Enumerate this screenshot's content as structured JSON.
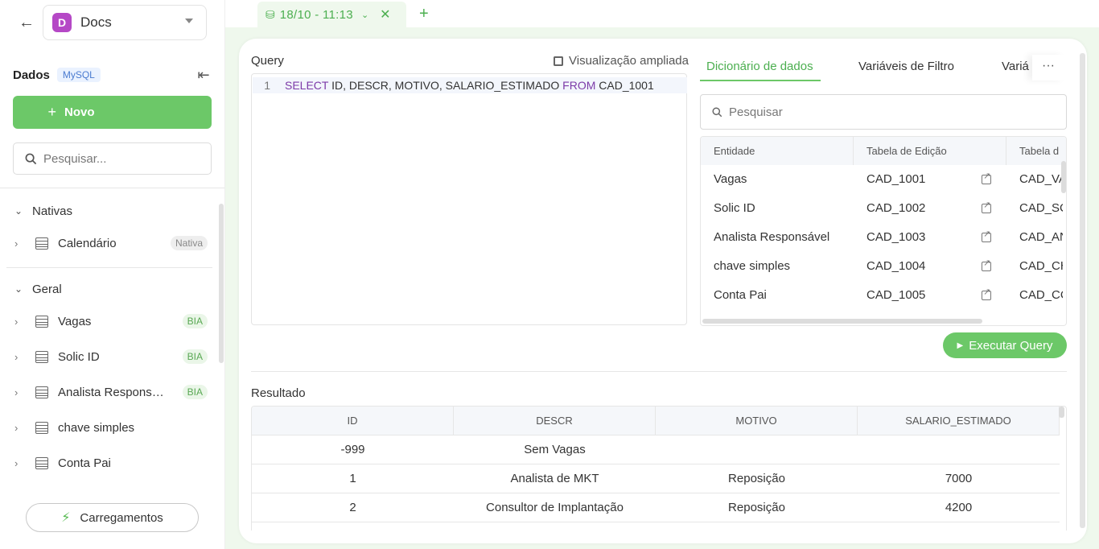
{
  "sidebar": {
    "app_badge": "D",
    "app_name": "Docs",
    "dados_label": "Dados",
    "db_type": "MySQL",
    "novo_label": "Novo",
    "search_placeholder": "Pesquisar...",
    "groups": [
      {
        "label": "Nativas",
        "items": [
          {
            "label": "Calendário",
            "badge": "Nativa"
          }
        ]
      },
      {
        "label": "Geral",
        "items": [
          {
            "label": "Vagas",
            "badge": "BIA"
          },
          {
            "label": "Solic ID",
            "badge": "BIA"
          },
          {
            "label": "Analista Responsável",
            "badge": "BIA"
          },
          {
            "label": "chave simples",
            "badge": ""
          },
          {
            "label": "Conta Pai",
            "badge": ""
          }
        ]
      }
    ],
    "carregamentos_label": "Carregamentos"
  },
  "tabbar": {
    "active_tab": "18/10 - 11:13"
  },
  "query": {
    "label": "Query",
    "expand_label": "Visualização ampliada",
    "line_number": "1",
    "sql": {
      "kw_select": "SELECT",
      "columns": " ID, DESCR, MOTIVO, SALARIO_ESTIMADO ",
      "kw_from": "FROM",
      "table": " CAD_1001"
    }
  },
  "right_panel": {
    "tabs": [
      "Dicionário de dados",
      "Variáveis de Filtro",
      "Variá"
    ],
    "more_label": "···",
    "search_placeholder": "Pesquisar",
    "columns": [
      "Entidade",
      "Tabela de Edição",
      "Tabela d"
    ],
    "rows": [
      {
        "entidade": "Vagas",
        "edicao": "CAD_1001",
        "outra": "CAD_VA"
      },
      {
        "entidade": "Solic ID",
        "edicao": "CAD_1002",
        "outra": "CAD_SC"
      },
      {
        "entidade": "Analista Responsável",
        "edicao": "CAD_1003",
        "outra": "CAD_AN"
      },
      {
        "entidade": "chave simples",
        "edicao": "CAD_1004",
        "outra": "CAD_CH"
      },
      {
        "entidade": "Conta Pai",
        "edicao": "CAD_1005",
        "outra": "CAD_CC"
      }
    ],
    "execute_label": "Executar Query"
  },
  "result": {
    "label": "Resultado",
    "columns": [
      "ID",
      "DESCR",
      "MOTIVO",
      "SALARIO_ESTIMADO"
    ],
    "rows": [
      [
        "-999",
        "Sem Vagas",
        "",
        ""
      ],
      [
        "1",
        "Analista de MKT",
        "Reposição",
        "7000"
      ],
      [
        "2",
        "Consultor de Implantação",
        "Reposição",
        "4200"
      ]
    ]
  },
  "colors": {
    "accent": "#6cc868",
    "accent_text": "#4caf50",
    "app_badge": "#b548c6",
    "sql_keyword": "#7c3aa8"
  }
}
